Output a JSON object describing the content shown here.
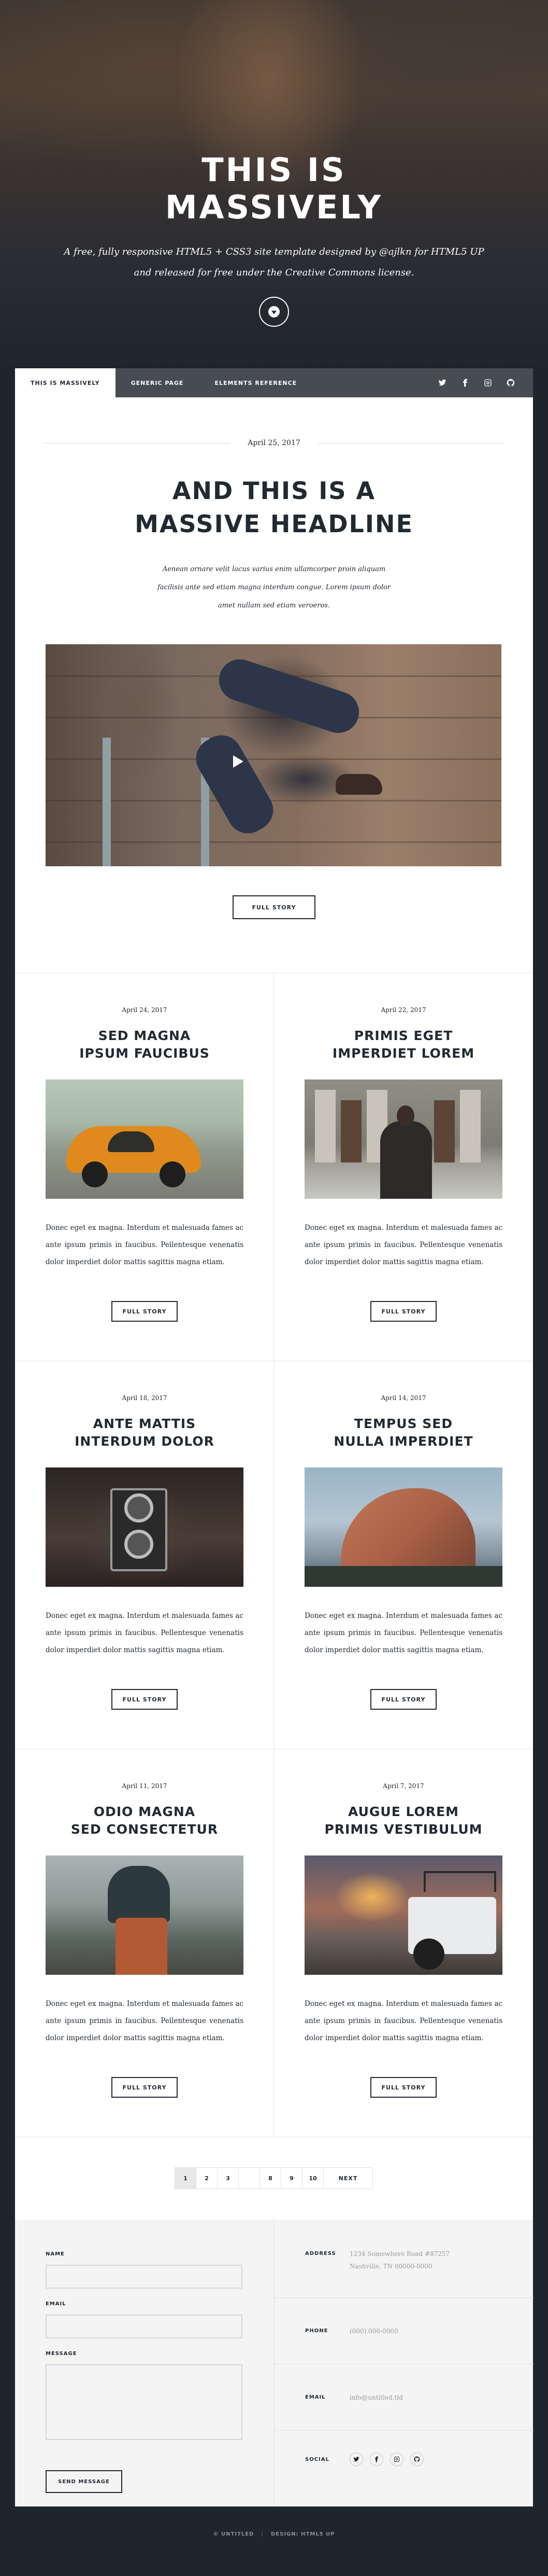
{
  "hero": {
    "title_line1": "THIS IS",
    "title_line2": "MASSIVELY",
    "subtitle_line1": "A free, fully responsive HTML5 + CSS3 site template designed by @ajlkn for HTML5 UP",
    "subtitle_line2": "and released for free under the Creative Commons license."
  },
  "nav": {
    "links": [
      "THIS IS MASSIVELY",
      "GENERIC PAGE",
      "ELEMENTS REFERENCE"
    ],
    "icons": [
      "twitter-icon",
      "facebook-icon",
      "instagram-icon",
      "github-icon"
    ]
  },
  "featured": {
    "date": "April 25, 2017",
    "title_line1": "AND THIS IS A",
    "title_line2": "MASSIVE HEADLINE",
    "text_line1": "Aenean ornare velit lacus varius enim ullamcorper proin aliquam",
    "text_line2": "facilisis ante sed etiam magna interdum congue. Lorem ipsum dolor",
    "text_line3": "amet nullam sed etiam veroeros.",
    "button": "FULL STORY"
  },
  "posts": [
    {
      "date": "April 24, 2017",
      "title_line1": "SED MAGNA",
      "title_line2": "IPSUM FAUCIBUS",
      "text": "Donec eget ex magna. Interdum et malesuada fames ac ante ipsum primis in faucibus. Pellentesque venenatis dolor imperdiet dolor mattis sagittis magna etiam.",
      "button": "FULL STORY"
    },
    {
      "date": "April 22, 2017",
      "title_line1": "PRIMIS EGET",
      "title_line2": "IMPERDIET LOREM",
      "text": "Donec eget ex magna. Interdum et malesuada fames ac ante ipsum primis in faucibus. Pellentesque venenatis dolor imperdiet dolor mattis sagittis magna etiam.",
      "button": "FULL STORY"
    },
    {
      "date": "April 18, 2017",
      "title_line1": "ANTE MATTIS",
      "title_line2": "INTERDUM DOLOR",
      "text": "Donec eget ex magna. Interdum et malesuada fames ac ante ipsum primis in faucibus. Pellentesque venenatis dolor imperdiet dolor mattis sagittis magna etiam.",
      "button": "FULL STORY"
    },
    {
      "date": "April 14, 2017",
      "title_line1": "TEMPUS SED",
      "title_line2": "NULLA IMPERDIET",
      "text": "Donec eget ex magna. Interdum et malesuada fames ac ante ipsum primis in faucibus. Pellentesque venenatis dolor imperdiet dolor mattis sagittis magna etiam.",
      "button": "FULL STORY"
    },
    {
      "date": "April 11, 2017",
      "title_line1": "ODIO MAGNA",
      "title_line2": "SED CONSECTETUR",
      "text": "Donec eget ex magna. Interdum et malesuada fames ac ante ipsum primis in faucibus. Pellentesque venenatis dolor imperdiet dolor mattis sagittis magna etiam.",
      "button": "FULL STORY"
    },
    {
      "date": "April 7, 2017",
      "title_line1": "AUGUE LOREM",
      "title_line2": "PRIMIS VESTIBULUM",
      "text": "Donec eget ex magna. Interdum et malesuada fames ac ante ipsum primis in faucibus. Pellentesque venenatis dolor imperdiet dolor mattis sagittis magna etiam.",
      "button": "FULL STORY"
    }
  ],
  "pagination": {
    "pages": [
      "1",
      "2",
      "3",
      "",
      "8",
      "9",
      "10"
    ],
    "active": "1",
    "next": "NEXT"
  },
  "footer": {
    "form": {
      "name_label": "NAME",
      "email_label": "EMAIL",
      "message_label": "MESSAGE",
      "submit": "SEND MESSAGE"
    },
    "contact": {
      "address_label": "ADDRESS",
      "address_line1": "1234 Somewhere Road #87257",
      "address_line2": "Nashville, TN 00000-0000",
      "phone_label": "PHONE",
      "phone": "(000) 000-0000",
      "email_label": "EMAIL",
      "email": "info@untitled.tld",
      "social_label": "SOCIAL",
      "social_icons": [
        "twitter-icon",
        "facebook-icon",
        "instagram-icon",
        "github-icon"
      ]
    }
  },
  "copyright": {
    "left": "© UNTITLED",
    "right": "DESIGN: HTML5 UP"
  },
  "colors": {
    "dark": "#212931",
    "background": "#1e252d",
    "panel": "#ffffff",
    "footer": "#f4f4f4"
  }
}
